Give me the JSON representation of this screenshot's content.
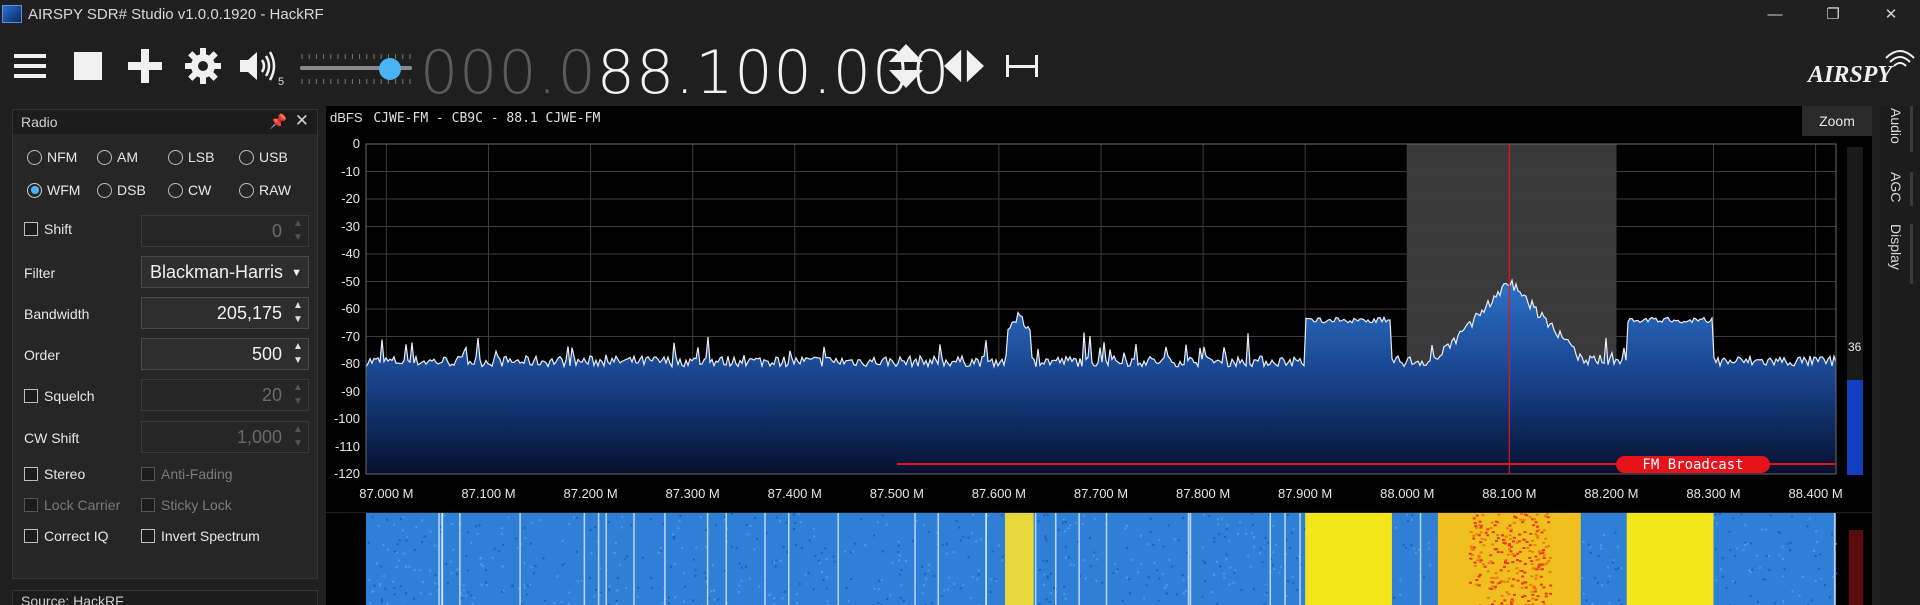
{
  "window": {
    "title": "AIRSPY SDR# Studio v1.0.0.1920 - HackRF",
    "buttons": {
      "minimize": "—",
      "maximize": "❐",
      "close": "✕"
    }
  },
  "toolbar": {
    "icons": [
      "menu-icon",
      "stop-icon",
      "add-icon",
      "settings-icon",
      "volume-icon"
    ],
    "volume_badge": "5",
    "volume_level": 0.72,
    "frequency_dim": "000.0",
    "frequency_bright": "88.100.000",
    "logo_text": "AIRSPY"
  },
  "radio_panel": {
    "title": "Radio",
    "modes_row1": [
      "NFM",
      "AM",
      "LSB",
      "USB"
    ],
    "modes_row2": [
      "WFM",
      "DSB",
      "CW",
      "RAW"
    ],
    "selected_mode": "WFM",
    "shift": {
      "label": "Shift",
      "value": "0"
    },
    "filter": {
      "label": "Filter",
      "value": "Blackman-Harris"
    },
    "bandwidth": {
      "label": "Bandwidth",
      "value": "205,175"
    },
    "order": {
      "label": "Order",
      "value": "500"
    },
    "squelch": {
      "label": "Squelch",
      "value": "20"
    },
    "cw_shift": {
      "label": "CW Shift",
      "value": "1,000"
    },
    "stereo": "Stereo",
    "anti_fading": "Anti-Fading",
    "lock_carrier": "Lock Carrier",
    "sticky_lock": "Sticky Lock",
    "correct_iq": "Correct IQ",
    "invert_spectrum": "Invert Spectrum"
  },
  "source_panel": {
    "title": "Source: HackRF"
  },
  "spectrum": {
    "unit": "dBFS",
    "station": "CJWE-FM  - CB9C - 88.1 CJWE-FM",
    "zoom_label": "Zoom",
    "db_ticks": [
      "0",
      "-10",
      "-20",
      "-30",
      "-40",
      "-50",
      "-60",
      "-70",
      "-80",
      "-90",
      "-100",
      "-110",
      "-120"
    ],
    "freq_ticks": [
      "87.000 M",
      "87.100 M",
      "87.200 M",
      "87.300 M",
      "87.400 M",
      "87.500 M",
      "87.600 M",
      "87.700 M",
      "87.800 M",
      "87.900 M",
      "88.000 M",
      "88.100 M",
      "88.200 M",
      "88.300 M",
      "88.400 M"
    ],
    "band_label": "FM Broadcast",
    "level_value": "36",
    "level_fraction": 0.29
  },
  "side_tabs": [
    "Audio",
    "AGC",
    "Display"
  ],
  "colors": {
    "accent": "#4ab3f4",
    "band": "#e8121b",
    "spectrum_fill": "#1f5aa8"
  }
}
